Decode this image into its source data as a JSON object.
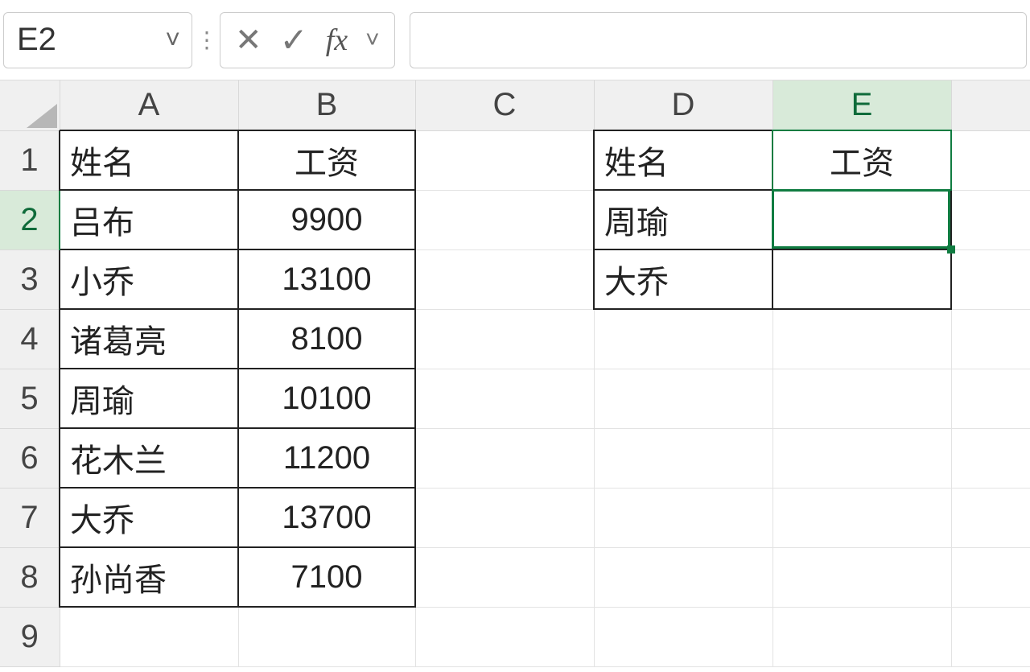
{
  "name_box": {
    "cell_ref": "E2"
  },
  "fx": {
    "cancel_icon": "✕",
    "accept_icon": "✓",
    "fx_label": "fx",
    "caret": "˅"
  },
  "formula_input": "",
  "columns": [
    "A",
    "B",
    "C",
    "D",
    "E"
  ],
  "rows": [
    "1",
    "2",
    "3",
    "4",
    "5",
    "6",
    "7",
    "8",
    "9"
  ],
  "selected_column": "E",
  "selected_row": "2",
  "cells": {
    "A1": "姓名",
    "B1": "工资",
    "A2": "吕布",
    "B2": "9900",
    "A3": "小乔",
    "B3": "13100",
    "A4": "诸葛亮",
    "B4": "8100",
    "A5": "周瑜",
    "B5": "10100",
    "A6": "花木兰",
    "B6": "11200",
    "A7": "大乔",
    "B7": "13700",
    "A8": "孙尚香",
    "B8": "7100",
    "D1": "姓名",
    "E1": "工资",
    "D2": "周瑜",
    "E2": "",
    "D3": "大乔",
    "E3": ""
  }
}
